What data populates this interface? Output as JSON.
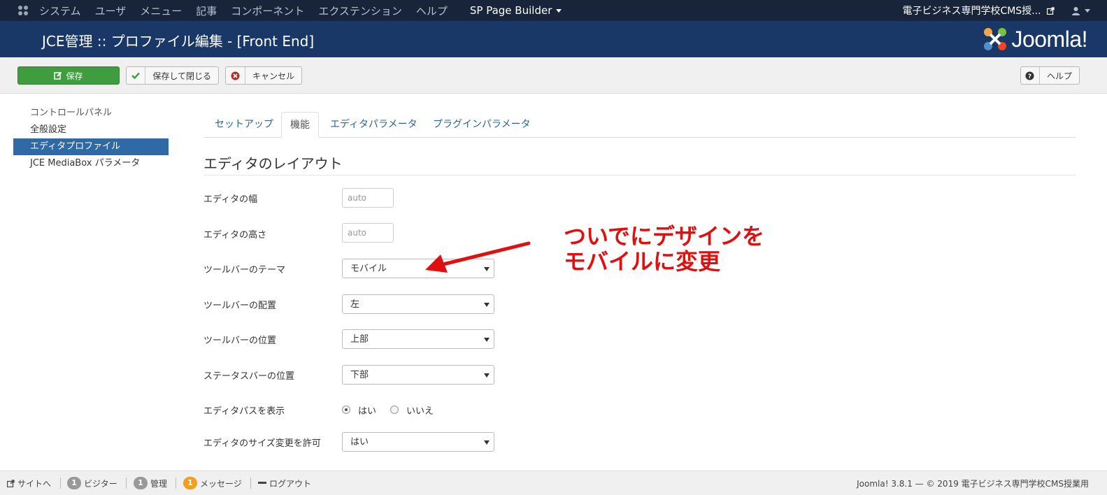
{
  "topnav": {
    "menu": [
      "システム",
      "ユーザ",
      "メニュー",
      "記事",
      "コンポーネント",
      "エクステンション",
      "ヘルプ"
    ],
    "page_builder": "SP Page Builder",
    "site_link": "電子ビジネス専門学校CMS授..."
  },
  "header": {
    "title": "JCE管理 :: プロファイル編集 - [Front End]",
    "brand": "Joomla!"
  },
  "toolbar": {
    "save": "保存",
    "save_close": "保存して閉じる",
    "cancel": "キャンセル",
    "help": "ヘルプ"
  },
  "sidebar": {
    "items": [
      "コントロールパネル",
      "全般設定",
      "エディタプロファイル",
      "JCE MediaBox パラメータ"
    ],
    "active_index": 2
  },
  "tabs": [
    "セットアップ",
    "機能",
    "エディタパラメータ",
    "プラグインパラメータ"
  ],
  "section": {
    "title": "エディタのレイアウト"
  },
  "fields": {
    "width": {
      "label": "エディタの幅",
      "placeholder": "auto"
    },
    "height": {
      "label": "エディタの高さ",
      "placeholder": "auto"
    },
    "toolbar_theme": {
      "label": "ツールバーのテーマ",
      "value": "モバイル"
    },
    "toolbar_align": {
      "label": "ツールバーの配置",
      "value": "左"
    },
    "toolbar_position": {
      "label": "ツールバーの位置",
      "value": "上部"
    },
    "statusbar_position": {
      "label": "ステータスバーの位置",
      "value": "下部"
    },
    "show_path": {
      "label": "エディタパスを表示",
      "yes": "はい",
      "no": "いいえ",
      "selected": "はい"
    },
    "resize": {
      "label": "エディタのサイズ変更を許可",
      "value": "はい"
    }
  },
  "annotation": {
    "line1": "ついでにデザインを",
    "line2": "モバイルに変更",
    "color": "#e01010"
  },
  "footer": {
    "site": "サイトへ",
    "visitors_count": "1",
    "visitors": "ビジター",
    "admin_count": "1",
    "admin": "管理",
    "messages_count": "1",
    "messages": "メッセージ",
    "logout": "ログアウト",
    "copyright": "Joomla! 3.8.1 — © 2019 電子ビジネス専門学校CMS授業用"
  },
  "colors": {
    "topnav_bg": "#17243a",
    "header_bg": "#1a3867",
    "save_green": "#3f9d3f",
    "sidebar_active": "#2f6aa6",
    "link_blue": "#2a6496"
  }
}
